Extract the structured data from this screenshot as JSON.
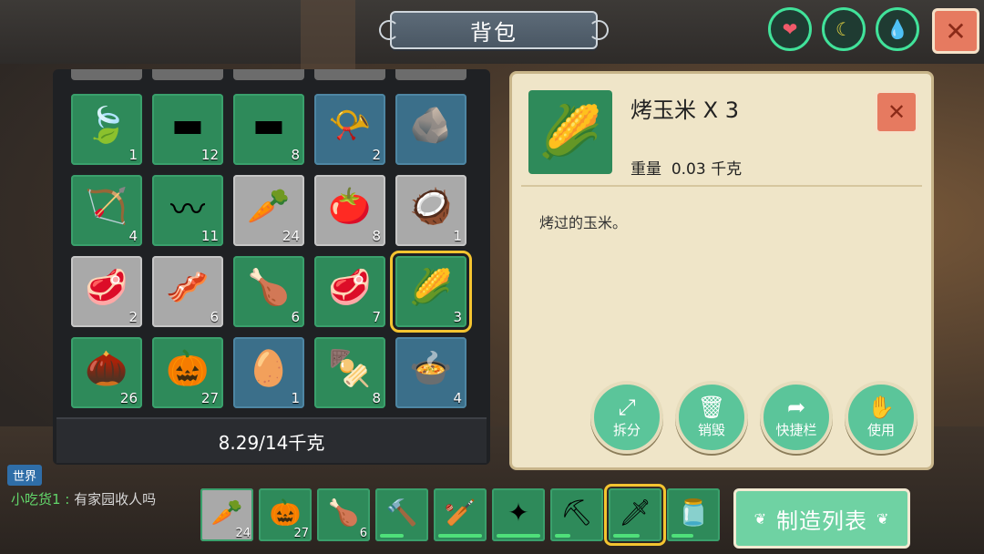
{
  "title": "背包",
  "status": {
    "health_icon": "heart-icon",
    "hunger_icon": "banana-icon",
    "water_icon": "water-drop-icon",
    "colors": {
      "ring": "#41e29a",
      "health": "#f05a6a",
      "hunger": "#e0d040",
      "water": "#3ac8e0"
    }
  },
  "close_label": "✕",
  "inventory": {
    "slots": [
      {
        "icon": "leaf-icon",
        "glyph": "🍃",
        "count": "1",
        "style": "green"
      },
      {
        "icon": "iron-ingot-icon",
        "glyph": "▬",
        "count": "12",
        "style": "green"
      },
      {
        "icon": "silver-ingot-icon",
        "glyph": "▬",
        "count": "8",
        "style": "green"
      },
      {
        "icon": "horn-icon",
        "glyph": "📯",
        "count": "2",
        "style": "blue"
      },
      {
        "icon": "stone-icon",
        "glyph": "🪨",
        "count": "",
        "style": "blue"
      },
      {
        "icon": "arrows-icon",
        "glyph": "🏹",
        "count": "4",
        "style": "green"
      },
      {
        "icon": "eel-icon",
        "glyph": "〰",
        "count": "11",
        "style": "green"
      },
      {
        "icon": "carrot-icon",
        "glyph": "🥕",
        "count": "24",
        "style": "grey"
      },
      {
        "icon": "tomato-icon",
        "glyph": "🍅",
        "count": "8",
        "style": "grey"
      },
      {
        "icon": "coconut-icon",
        "glyph": "🥥",
        "count": "1",
        "style": "grey"
      },
      {
        "icon": "raw-meat-icon",
        "glyph": "🥩",
        "count": "2",
        "style": "grey"
      },
      {
        "icon": "bacon-icon",
        "glyph": "🥓",
        "count": "6",
        "style": "grey"
      },
      {
        "icon": "chicken-leg-icon",
        "glyph": "🍗",
        "count": "6",
        "style": "green"
      },
      {
        "icon": "steak-icon",
        "glyph": "🥩",
        "count": "7",
        "style": "green"
      },
      {
        "icon": "roasted-corn-icon",
        "glyph": "🌽",
        "count": "3",
        "style": "green",
        "selected": true
      },
      {
        "icon": "roasted-nut-icon",
        "glyph": "🌰",
        "count": "26",
        "style": "green"
      },
      {
        "icon": "roasted-pumpkin-icon",
        "glyph": "🎃",
        "count": "27",
        "style": "green"
      },
      {
        "icon": "egg-icon",
        "glyph": "🥚",
        "count": "1",
        "style": "blue"
      },
      {
        "icon": "kebab-icon",
        "glyph": "🍢",
        "count": "8",
        "style": "green"
      },
      {
        "icon": "stew-bowl-icon",
        "glyph": "🍲",
        "count": "4",
        "style": "blue"
      }
    ],
    "weight": "8.29/14千克"
  },
  "detail": {
    "icon": "roasted-corn-icon",
    "glyph": "🌽",
    "name": "烤玉米 X 3",
    "weight_label": "重量",
    "weight_value": "0.03 千克",
    "description": "烤过的玉米。",
    "actions": [
      {
        "id": "split",
        "label": "拆分",
        "icon": "split-arrows-icon",
        "glyph": "⤢"
      },
      {
        "id": "destroy",
        "label": "销毁",
        "icon": "trash-icon",
        "glyph": "🗑"
      },
      {
        "id": "quickbar",
        "label": "快捷栏",
        "icon": "back-arrow-icon",
        "glyph": "➦"
      },
      {
        "id": "use",
        "label": "使用",
        "icon": "hand-icon",
        "glyph": "✋"
      }
    ]
  },
  "chat": {
    "channel": "世界",
    "sender": "小吃货1 :",
    "message": "有家园收人吗"
  },
  "hotbar": [
    {
      "icon": "carrot-icon",
      "glyph": "🥕",
      "count": "24",
      "style": "grey"
    },
    {
      "icon": "roasted-pumpkin-icon",
      "glyph": "🎃",
      "count": "27",
      "style": "green"
    },
    {
      "icon": "chicken-leg-icon",
      "glyph": "🍗",
      "count": "6",
      "style": "green"
    },
    {
      "icon": "wooden-club-icon",
      "glyph": "🔨",
      "count": "",
      "style": "green",
      "durability": 0.55
    },
    {
      "icon": "vine-club-icon",
      "glyph": "🏏",
      "count": "",
      "style": "green",
      "durability": 1.0
    },
    {
      "icon": "crystal-staff-icon",
      "glyph": "✦",
      "count": "",
      "style": "green",
      "durability": 1.0
    },
    {
      "icon": "pickaxe-icon",
      "glyph": "⛏",
      "count": "",
      "style": "green",
      "durability": 0.35
    },
    {
      "icon": "sword-icon",
      "glyph": "🗡",
      "count": "",
      "style": "green",
      "durability": 0.6,
      "selected": true
    },
    {
      "icon": "water-flask-icon",
      "glyph": "🫙",
      "count": "",
      "style": "green",
      "durability": 0.5
    }
  ],
  "craft_button": "制造列表"
}
